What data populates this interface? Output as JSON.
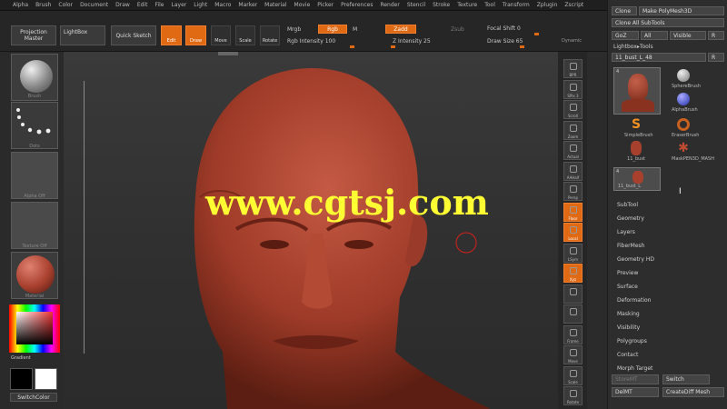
{
  "menubar": [
    "Alpha",
    "Brush",
    "Color",
    "Document",
    "Draw",
    "Edit",
    "File",
    "Layer",
    "Light",
    "Macro",
    "Marker",
    "Material",
    "Movie",
    "Picker",
    "Preferences",
    "Render",
    "Stencil",
    "Stroke",
    "Texture",
    "Tool",
    "Transform",
    "Zplugin",
    "Zscript"
  ],
  "toolbar": {
    "projection_master": "Projection Master",
    "lightbox": "LightBox",
    "quick_sketch": "Quick Sketch",
    "edit": "Edit",
    "draw": "Draw",
    "move": "Move",
    "scale": "Scale",
    "rotate": "Rotate",
    "mrgb": "Mrgb",
    "rgb": "Rgb",
    "m": "M",
    "rgb_intensity": "Rgb Intensity 100",
    "zadd": "Zadd",
    "zsub": "Zsub",
    "z_intensity": "Z Intensity 25",
    "focal_shift": "Focal Shift 0",
    "draw_size": "Draw Size 65",
    "dynamic": "Dynamic"
  },
  "left_shelf": {
    "brush": "Brush",
    "stroke": "Dots",
    "alpha": "Alpha Off",
    "texture": "Texture Off",
    "material": "Material",
    "gradient": "Gradient",
    "switch_color": "SwitchColor"
  },
  "right_shelf": [
    "BPR",
    "SPix 3",
    "Scroll",
    "Zoom",
    "Actual",
    "AAHalf",
    "Persp",
    "Floor",
    "Local",
    "LSym",
    "Xyz",
    "",
    "",
    "Frame",
    "Move",
    "Scale",
    "Rotate"
  ],
  "tray": {
    "clone": "Clone",
    "make_polymesh": "Make PolyMesh3D",
    "clone_all": "Clone All SubTools",
    "goz": "GoZ",
    "all": "All",
    "visible": "Visible",
    "r": "R",
    "lightbox_tools": "Lightbox▸Tools",
    "current_tool": "11_bust_L_48",
    "r2": "R",
    "tool_count": "4",
    "tools": [
      "SphereBrush",
      "AlphaBrush",
      "SimpleBrush",
      "EraserBrush",
      "11_bust",
      "MaskPEN3D_MASH"
    ],
    "tool_count2": "4",
    "small_tool": "11_bust_L",
    "menu": [
      "SubTool",
      "Geometry",
      "Layers",
      "FiberMesh",
      "Geometry HD",
      "Preview",
      "Surface",
      "Deformation",
      "Masking",
      "Visibility",
      "Polygroups",
      "Contact"
    ],
    "morph_target": "Morph Target",
    "store_mt": "StoreMT",
    "switch": "Switch",
    "del_mt": "DelMT",
    "create_diff": "CreateDiff Mesh"
  },
  "watermark": "www.cgtsj.com",
  "colors": {
    "accent": "#e06a14",
    "clay": "#a8402e",
    "watermark": "#ffff33"
  }
}
